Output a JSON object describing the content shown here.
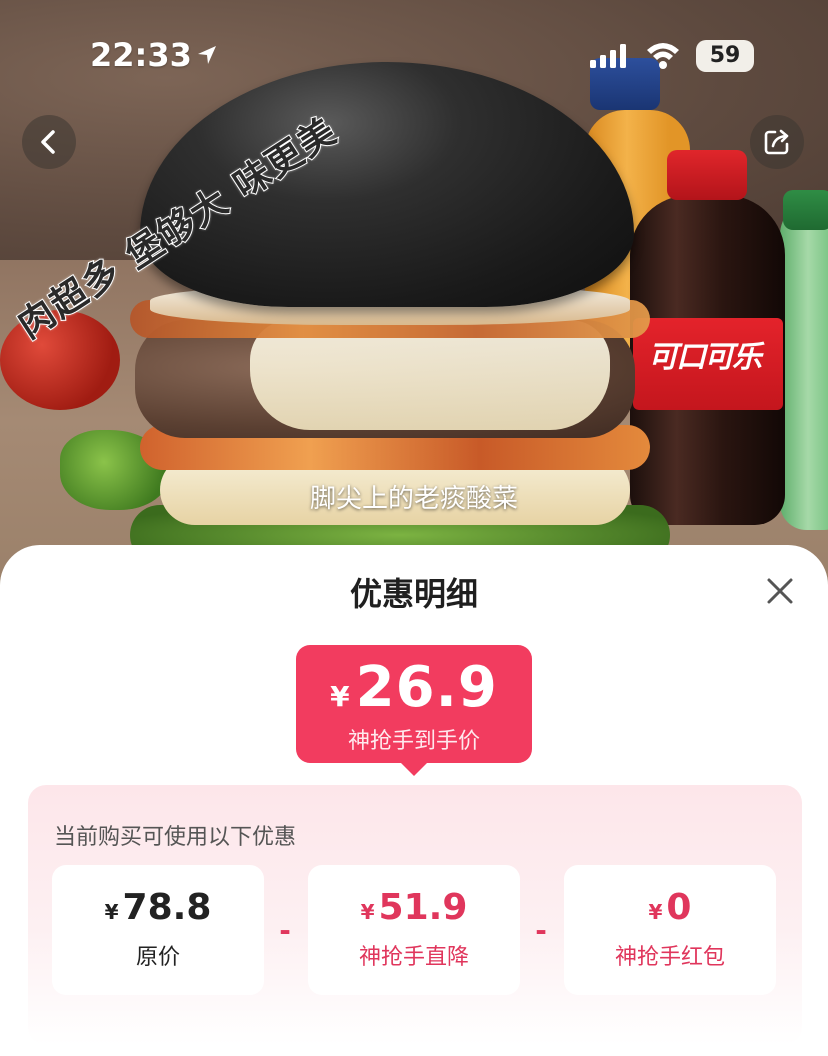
{
  "status_bar": {
    "time": "22:33",
    "battery": "59"
  },
  "hero": {
    "slogan": "肉超多 堡够大 味更美",
    "caption": "脚尖上的老痰酸菜",
    "coke_logo": "可口可乐"
  },
  "sheet": {
    "title": "优惠明细",
    "final_price": {
      "currency": "¥",
      "value": "26.9",
      "label": "神抢手到手价"
    },
    "discount_title": "当前购买可使用以下优惠",
    "items": [
      {
        "currency": "¥",
        "value": "78.8",
        "label": "原价"
      },
      {
        "currency": "¥",
        "value": "51.9",
        "label": "神抢手直降"
      },
      {
        "currency": "¥",
        "value": "0",
        "label": "神抢手红包"
      }
    ],
    "operator": "-"
  },
  "colors": {
    "accent": "#f23c5f",
    "discount_text": "#e0365c"
  }
}
